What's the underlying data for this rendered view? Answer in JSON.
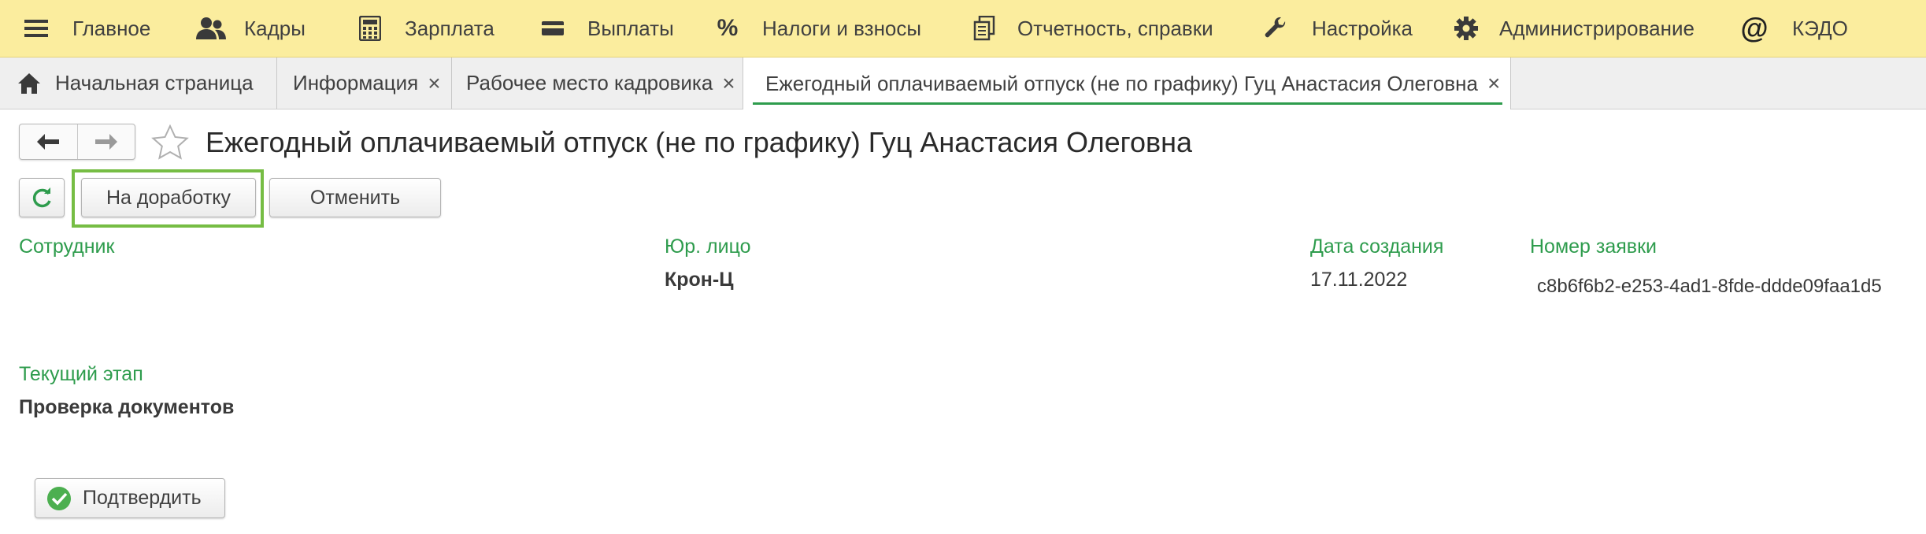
{
  "menu": {
    "items": [
      {
        "label": "Главное",
        "icon": "hamburger-icon"
      },
      {
        "label": "Кадры",
        "icon": "people-icon"
      },
      {
        "label": "Зарплата",
        "icon": "calculator-icon"
      },
      {
        "label": "Выплаты",
        "icon": "wallet-icon"
      },
      {
        "label": "Налоги и взносы",
        "icon": "percent-icon",
        "glyph": "%"
      },
      {
        "label": "Отчетность, справки",
        "icon": "reports-icon"
      },
      {
        "label": "Настройка",
        "icon": "wrench-icon"
      },
      {
        "label": "Администрирование",
        "icon": "gear-icon"
      },
      {
        "label": "КЭДО",
        "icon": "at-icon",
        "glyph": "@"
      }
    ]
  },
  "tabs": [
    {
      "label": "Начальная страница",
      "icon": "home-icon"
    },
    {
      "label": "Информация",
      "close": "×"
    },
    {
      "label": "Рабочее место кадровика",
      "close": "×"
    },
    {
      "label": "Ежегодный оплачиваемый отпуск (не по графику) Гуц Анастасия Олеговна",
      "close": "×",
      "active": true
    }
  ],
  "document": {
    "title": "Ежегодный оплачиваемый отпуск (не по графику) Гуц Анастасия Олеговна"
  },
  "toolbar": {
    "refresh_icon": "refresh-icon",
    "rework_label": "На доработку",
    "cancel_label": "Отменить"
  },
  "fields": {
    "employee_label": "Сотрудник",
    "employee_value": "",
    "legal_entity_label": "Юр. лицо",
    "legal_entity_value": "Крон-Ц",
    "created_date_label": "Дата создания",
    "created_date_value": "17.11.2022",
    "request_number_label": "Номер заявки",
    "request_number_value": "c8b6f6b2-e253-4ad1-8fde-ddde09faa1d5",
    "current_stage_label": "Текущий этап",
    "current_stage_value": "Проверка документов"
  },
  "actions": {
    "confirm_label": "Подтвердить"
  },
  "colors": {
    "menu_bg": "#fbed9e",
    "accent_green": "#2e9c4d",
    "highlight_green": "#76bd44"
  }
}
